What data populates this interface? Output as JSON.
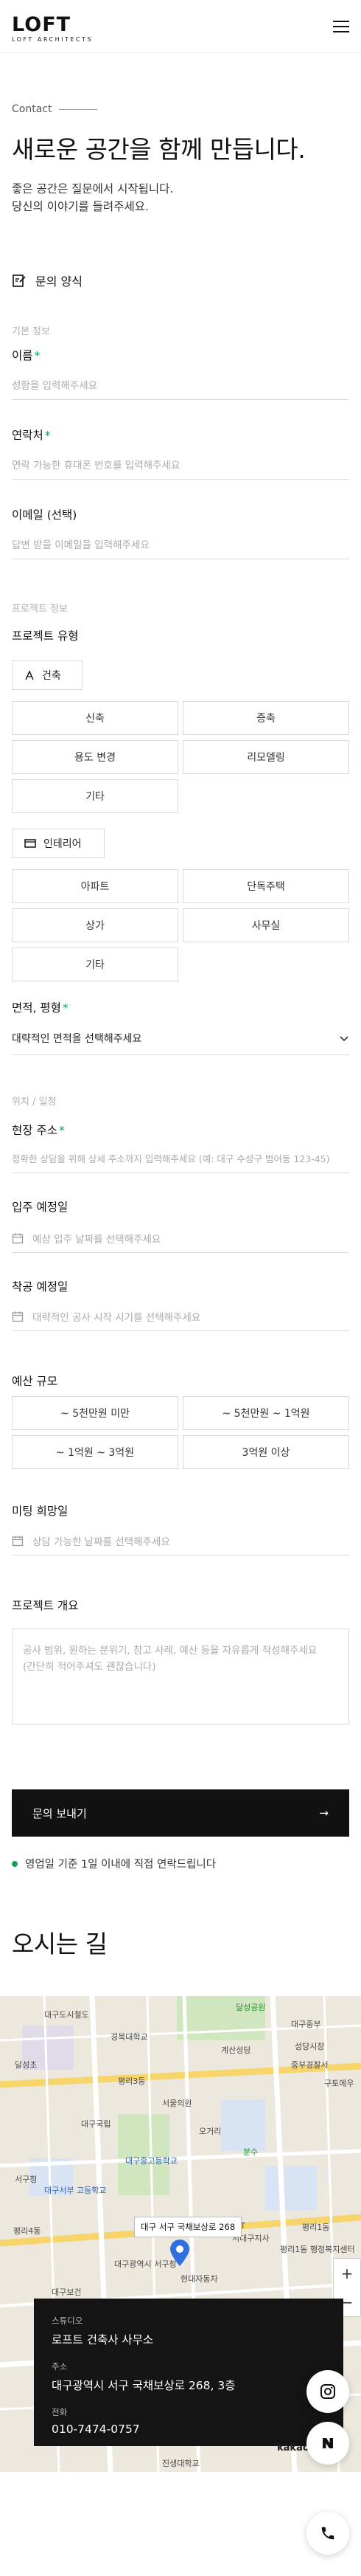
{
  "header": {
    "logo": "LOFT",
    "logo_sub": "LOFT ARCHITECTS"
  },
  "hero": {
    "eyebrow": "Contact",
    "title": "새로운 공간을 함께 만듭니다.",
    "desc_line1": "좋은 공간은 질문에서 시작됩니다.",
    "desc_line2": "당신의 이야기를 들려주세요."
  },
  "form": {
    "heading": "문의 양식",
    "basic_group": "기본 정보",
    "name_label": "이름",
    "name_placeholder": "성함을 입력해주세요",
    "phone_label": "연락처",
    "phone_placeholder": "연락 가능한 휴대폰 번호를 입력해주세요",
    "email_label": "이메일 (선택)",
    "email_placeholder": "답변 받을 이메일을 입력해주세요",
    "project_group": "프로젝트 정보",
    "type_label": "프로젝트 유형",
    "arch_label": "건축",
    "arch_options": [
      "신축",
      "증축",
      "용도 변경",
      "리모델링",
      "기타"
    ],
    "interior_label": "인테리어",
    "interior_options": [
      "아파트",
      "단독주택",
      "상가",
      "사무실",
      "기타"
    ],
    "area_label": "면적, 평형",
    "area_value": "대략적인 면적을 선택해주세요",
    "location_group": "위치 / 일정",
    "site_label": "현장 주소",
    "site_placeholder": "정확한 상담을 위해 상세 주소까지 입력해주세요 (예: 대구 수성구 범어동 123-45)",
    "movein_label": "입주 예정일",
    "movein_placeholder": "예상 입주 날짜를 선택해주세요",
    "start_label": "착공 예정일",
    "start_placeholder": "대략적인 공사 시작 시기를 선택해주세요",
    "budget_label": "예산 규모",
    "budget_options": [
      "~ 5천만원 미만",
      "~ 5천만원 ~ 1억원",
      "~ 1억원 ~ 3억원",
      "3억원 이상"
    ],
    "meeting_label": "미팅 희망일",
    "meeting_placeholder": "상담 가능한 날짜를 선택해주세요",
    "overview_label": "프로젝트 개요",
    "overview_placeholder_1": "공사 범위, 원하는 분위기, 참고 사례, 예산 등을 자유롭게 작성해주세요",
    "overview_placeholder_2": "(간단히 적어주셔도 괜찮습니다)",
    "submit_label": "문의 보내기",
    "submit_arrow": "→",
    "reply_note": "영업일 기준 1일 이내에 직접 연락드립니다"
  },
  "directions": {
    "title": "오시는 길",
    "map_callout": "대구 서구 국채보상로 268",
    "studio_key": "스튜디오",
    "studio_value": "로프트 건축사 사무소",
    "address_key": "주소",
    "address_value": "대구광역시 서구 국채보상로 268, 3층",
    "phone_key": "전화",
    "phone_value": "010-7474-0757",
    "kakao": "kakao",
    "map_labels": [
      "달성공원",
      "대구도시철도",
      "경북대학교",
      "대구중부",
      "계산성당",
      "달성초",
      "평리3동",
      "서울의원",
      "대구국립",
      "오거리",
      "분수",
      "서구청",
      "대구광역시 서구청",
      "현대자동차",
      "평리4동",
      "평리1동",
      "대구보건",
      "성당시장",
      "대구중고등학교",
      "KT",
      "서대구지사",
      "대구서부 고등학교",
      "중부경찰서",
      "구토에우",
      "평리1동 행정복지센터",
      "진생대학교"
    ]
  },
  "colors": {
    "accent": "#18a05a",
    "dark": "#111111",
    "border": "#d9d9d9"
  },
  "icons": [
    "menu-icon",
    "form-icon",
    "building-icon",
    "interior-icon",
    "chevron-down-icon",
    "calendar-icon",
    "arrow-right-icon",
    "map-pin-icon",
    "instagram-icon",
    "naver-icon",
    "phone-icon"
  ]
}
